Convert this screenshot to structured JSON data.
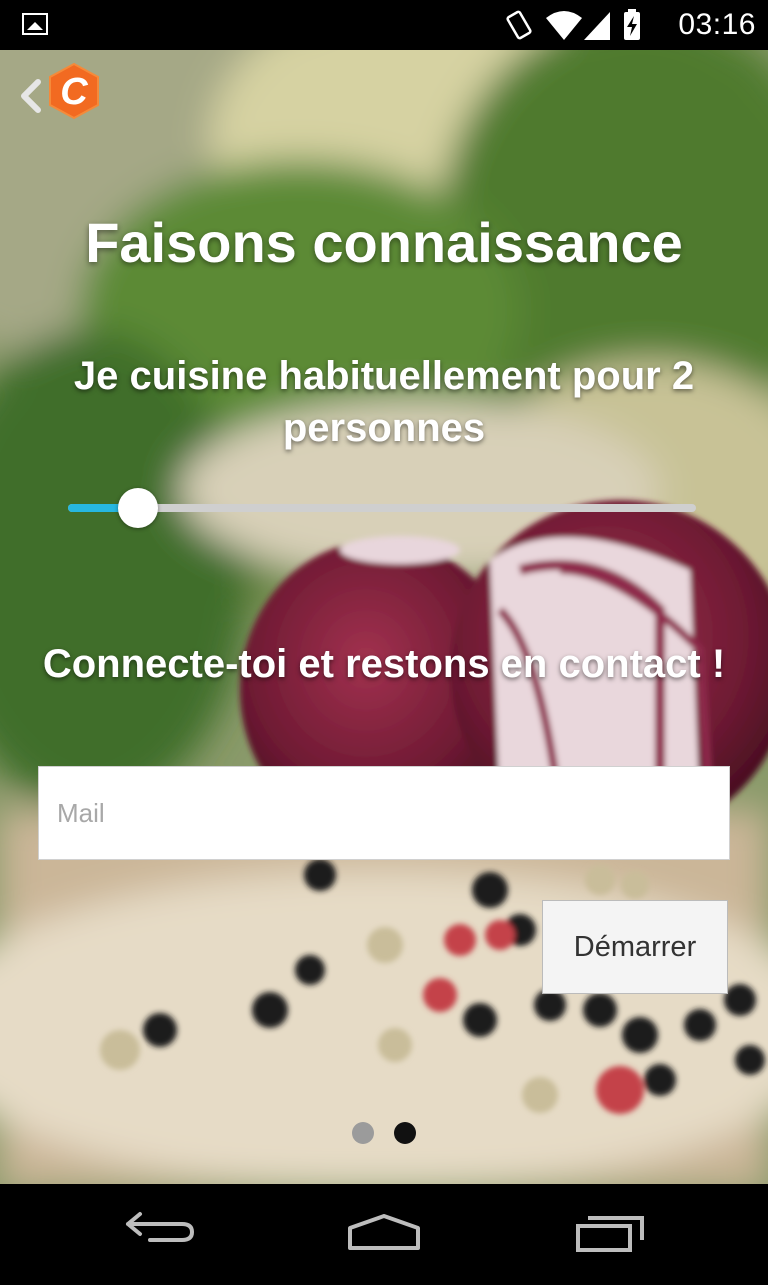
{
  "status_bar": {
    "time": "03:16",
    "icons": [
      "gallery-icon",
      "vibrate-icon",
      "wifi-icon",
      "signal-icon",
      "battery-charging-icon"
    ]
  },
  "header": {
    "back_icon": "chevron-left-icon",
    "logo_letter": "C",
    "logo_color": "#f26a21"
  },
  "main": {
    "title": "Faisons connaissance",
    "servings_text": "Je cuisine habituellement pour 2 personnes",
    "slider": {
      "value": 2,
      "min": 1,
      "max": 10,
      "fill_color": "#27b7e0"
    },
    "connect_text": "Connecte-toi et restons en contact !",
    "mail_placeholder": "Mail",
    "mail_value": "",
    "start_button": "Démarrer",
    "pager": {
      "pages": 2,
      "current": 2
    }
  },
  "nav_bar": {
    "icons": [
      "back-icon",
      "home-icon",
      "recents-icon"
    ]
  }
}
